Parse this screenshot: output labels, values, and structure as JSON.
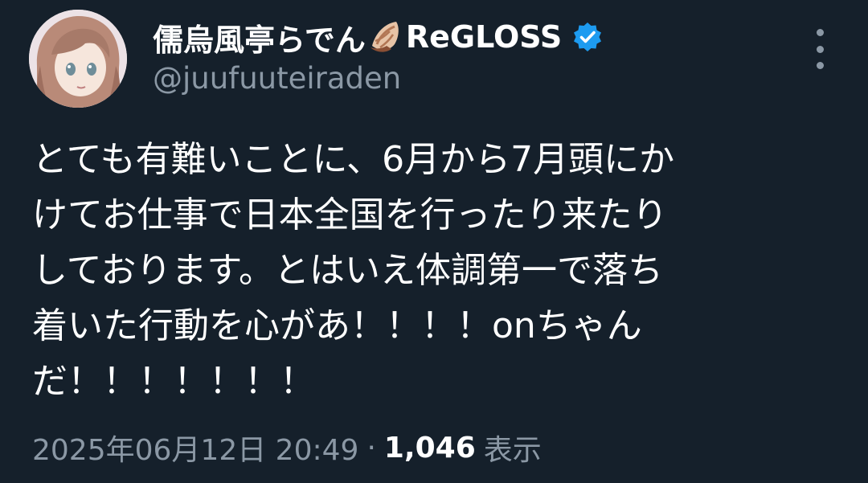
{
  "author": {
    "display_name": "儒烏風亭らでん",
    "shell_icon": "spiral-shell-emoji",
    "display_name_suffix": "ReGLOSS",
    "verified_icon": "verified-badge-icon",
    "handle": "@juufuuteiraden",
    "avatar_icon": "profile-avatar"
  },
  "menu": {
    "icon": "more-vertical-icon"
  },
  "tweet": {
    "lines": [
      "とても有難いことに、6月から7月頭にか",
      "けてお仕事で日本全国を行ったり来たり",
      "しております。とはいえ体調第一で落ち",
      "着いた行動を心があ！！！！onちゃん",
      "だ！！！！！！！"
    ]
  },
  "meta": {
    "timestamp": "2025年06月12日 20:49",
    "separator": "·",
    "views_count": "1,046",
    "views_label": "表示"
  },
  "colors": {
    "background": "#15202b",
    "text": "#ffffff",
    "secondary_text": "#8b98a5",
    "verified_blue": "#1d9bf0"
  }
}
